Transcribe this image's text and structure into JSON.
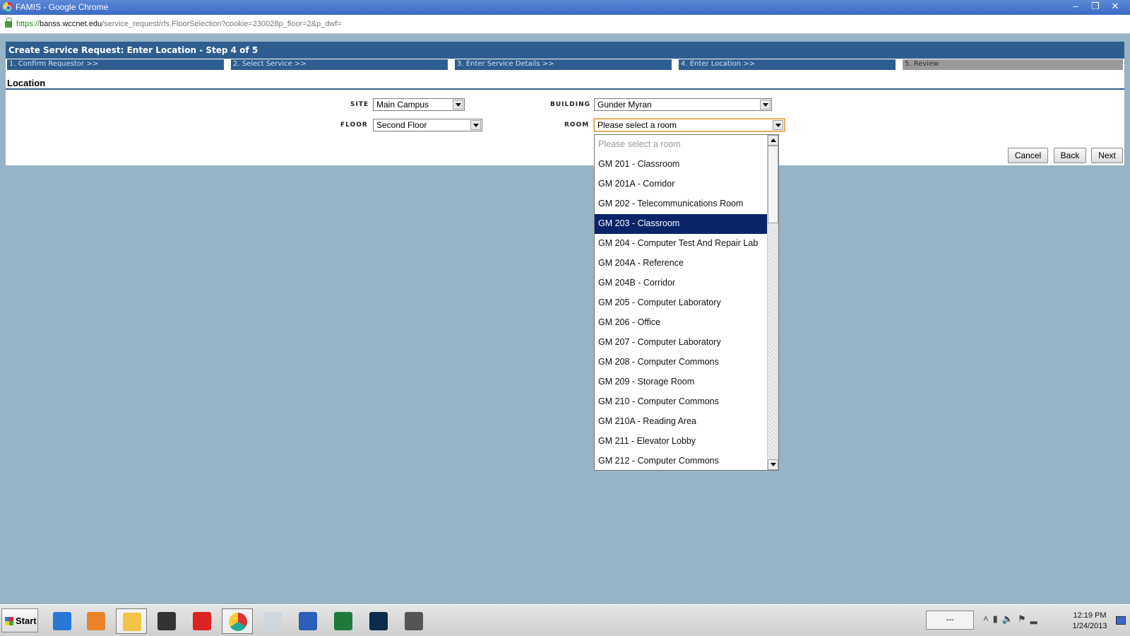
{
  "window": {
    "title": "FAMIS - Google Chrome",
    "url_scheme": "https://",
    "url_host": "banss.wccnet.edu",
    "url_path": "/service_request/rfs.FloorSelection?cookie=230028p_floor=2&p_dwf="
  },
  "header": {
    "title": "Create Service Request: Enter Location - Step 4 of 5"
  },
  "steps": [
    "1. Confirm Requestor >>",
    "2. Select Service >>",
    "3. Enter Service Details >>",
    "4. Enter Location >>",
    "5. Review"
  ],
  "section": {
    "title": "Location"
  },
  "form": {
    "site_label": "SITE",
    "site_value": "Main Campus",
    "building_label": "BUILDING",
    "building_value": "Gunder Myran",
    "floor_label": "FLOOR",
    "floor_value": "Second Floor",
    "room_label": "ROOM",
    "room_value": "Please select a room"
  },
  "buttons": {
    "cancel": "Cancel",
    "back": "Back",
    "next": "Next"
  },
  "room_options": [
    "Please select a room",
    "GM 201 - Classroom",
    "GM 201A - Corridor",
    "GM 202 - Telecommunications Room",
    "GM 203 - Classroom",
    "GM 204 - Computer Test And Repair Lab",
    "GM 204A - Reference",
    "GM 204B - Corridor",
    "GM 205 - Computer Laboratory",
    "GM 206 - Office",
    "GM 207 - Computer Laboratory",
    "GM 208 - Computer Commons",
    "GM 209 - Storage Room",
    "GM 210 - Computer Commons",
    "GM 210A - Reading Area",
    "GM 211 - Elevator Lobby",
    "GM 212 - Computer Commons"
  ],
  "room_highlighted": "GM 203 - Classroom",
  "taskbar": {
    "start_label": "Start",
    "icons": [
      "internet-explorer-icon",
      "media-player-icon",
      "file-explorer-icon",
      "scanner-icon",
      "shopping-cart-icon",
      "chrome-icon",
      "calculator-icon",
      "word-icon",
      "excel-icon",
      "photoshop-icon",
      "device-icon"
    ],
    "tray_box_text": "---",
    "time": "12:19 PM",
    "date": "1/24/2013"
  },
  "colors": {
    "header": "#2f5d8f",
    "desktop": "#97b3c6",
    "highlight": "#0a246a"
  }
}
